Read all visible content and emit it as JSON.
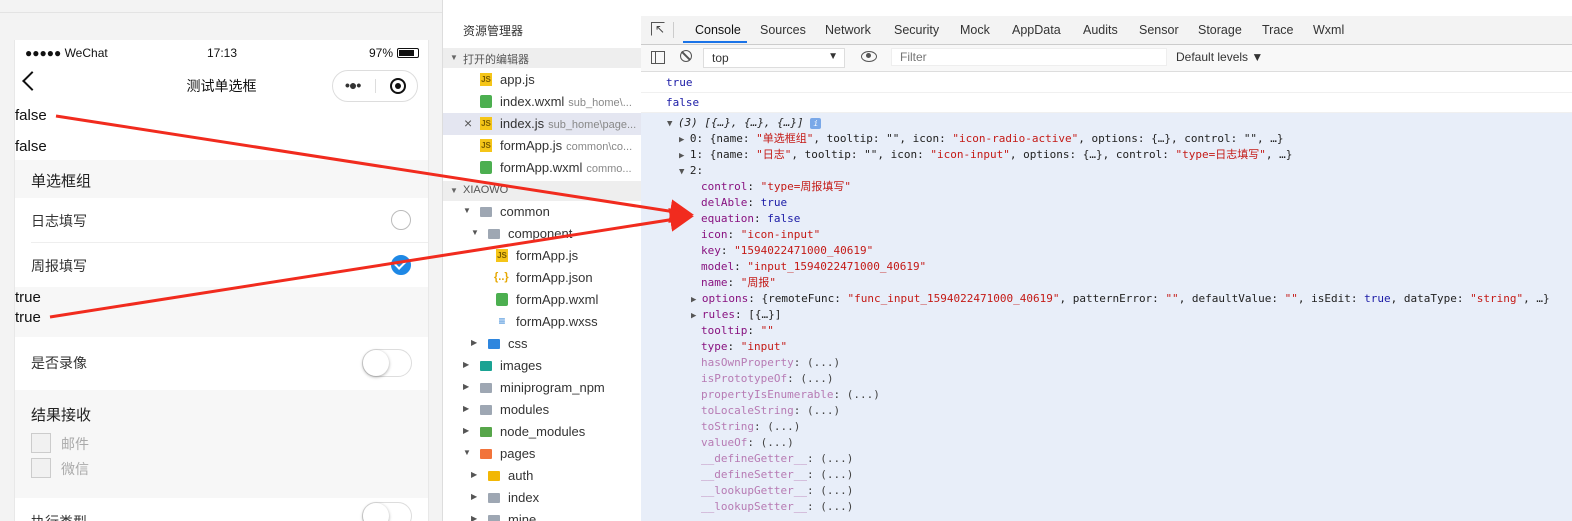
{
  "simulator": {
    "status": {
      "carrier": "●●●●● WeChat",
      "time": "17:13",
      "battery": "97%"
    },
    "nav_title": "测试单选框",
    "log_false_1": "false",
    "log_false_2": "false",
    "radio_group_title": "单选框组",
    "radio_options": [
      {
        "label": "日志填写",
        "checked": false
      },
      {
        "label": "周报填写",
        "checked": true
      }
    ],
    "log_true_1": "true",
    "log_true_2": "true",
    "record_label": "是否录像",
    "record_on": false,
    "result_title": "结果接收",
    "checkbox_options": [
      "邮件",
      "微信"
    ],
    "exec_type_label": "执行类型"
  },
  "explorer": {
    "header": "资源管理器",
    "open_editors_title": "打开的编辑器",
    "open_editors": [
      {
        "name": "app.js",
        "path": "",
        "type": "js"
      },
      {
        "name": "index.wxml",
        "path": "sub_home\\...",
        "type": "wxml"
      },
      {
        "name": "index.js",
        "path": "sub_home\\page...",
        "type": "js"
      },
      {
        "name": "formApp.js",
        "path": "common\\co...",
        "type": "js"
      },
      {
        "name": "formApp.wxml",
        "path": "commo...",
        "type": "wxml"
      }
    ],
    "project_title": "XIAOWO",
    "tree": [
      {
        "name": "common",
        "type": "folder"
      },
      {
        "name": "component",
        "type": "folder"
      },
      {
        "name": "formApp.js",
        "type": "js"
      },
      {
        "name": "formApp.json",
        "type": "json"
      },
      {
        "name": "formApp.wxml",
        "type": "wxml"
      },
      {
        "name": "formApp.wxss",
        "type": "wxss"
      },
      {
        "name": "css",
        "type": "folder"
      },
      {
        "name": "images",
        "type": "folder"
      },
      {
        "name": "miniprogram_npm",
        "type": "folder"
      },
      {
        "name": "modules",
        "type": "folder"
      },
      {
        "name": "node_modules",
        "type": "folder"
      },
      {
        "name": "pages",
        "type": "folder"
      },
      {
        "name": "auth",
        "type": "folder"
      },
      {
        "name": "index",
        "type": "folder"
      },
      {
        "name": "mine",
        "type": "folder"
      }
    ]
  },
  "devtools": {
    "tabs": [
      "Console",
      "Sources",
      "Network",
      "Security",
      "Mock",
      "AppData",
      "Audits",
      "Sensor",
      "Storage",
      "Trace",
      "Wxml"
    ],
    "active_tab": "Console",
    "context": "top",
    "filter_placeholder": "Filter",
    "levels": "Default levels ▼",
    "log_lines": [
      "true",
      "false"
    ],
    "array_summary": "(3) [{…}, {…}, {…}]",
    "item0_prefix": "0: {name: ",
    "item0_name": "\"单选框组\"",
    "item0_mid": ", tooltip: \"\", icon: ",
    "item0_icon": "\"icon-radio-active\"",
    "item0_rest": ", options: {…}, control: \"\", …}",
    "item1_prefix": "1: {name: ",
    "item1_name": "\"日志\"",
    "item1_mid": ", tooltip: \"\", icon: ",
    "item1_icon": "\"icon-input\"",
    "item1_mid2": ", options: {…}, control: ",
    "item1_control": "\"type=日志填写\"",
    "item1_rest": ", …}",
    "item2_label": "2:",
    "props": [
      {
        "key": "control",
        "value": "\"type=周报填写\"",
        "kind": "s"
      },
      {
        "key": "delAble",
        "value": "true",
        "kind": "b"
      },
      {
        "key": "equation",
        "value": "false",
        "kind": "b"
      },
      {
        "key": "icon",
        "value": "\"icon-input\"",
        "kind": "s"
      },
      {
        "key": "key",
        "value": "\"1594022471000_40619\"",
        "kind": "s"
      },
      {
        "key": "model",
        "value": "\"input_1594022471000_40619\"",
        "kind": "s"
      },
      {
        "key": "name",
        "value": "\"周报\"",
        "kind": "s"
      }
    ],
    "options_key": "options",
    "options_preview_a": ": {remoteFunc: ",
    "options_remote": "\"func_input_1594022471000_40619\"",
    "options_preview_b": ", patternError: ",
    "options_empty1": "\"\"",
    "options_preview_c": ", defaultValue: ",
    "options_empty2": "\"\"",
    "options_preview_d": ", isEdit: ",
    "options_isedit": "true",
    "options_preview_e": ", dataType: ",
    "options_datatype": "\"string\"",
    "options_preview_f": ", …}",
    "rules_key": "rules",
    "rules_value": ": [{…}]",
    "props2": [
      {
        "key": "tooltip",
        "value": "\"\""
      },
      {
        "key": "type",
        "value": "\"input\""
      }
    ],
    "methods": [
      "hasOwnProperty",
      "isPrototypeOf",
      "propertyIsEnumerable",
      "toLocaleString",
      "toString",
      "valueOf",
      "__defineGetter__",
      "__defineSetter__",
      "__lookupGetter__",
      "__lookupSetter__"
    ],
    "method_value": ": (...)"
  },
  "colors": {
    "arrow": "#f12b1e",
    "tab_active": "#1a73e8",
    "checked": "#1e88e5"
  }
}
